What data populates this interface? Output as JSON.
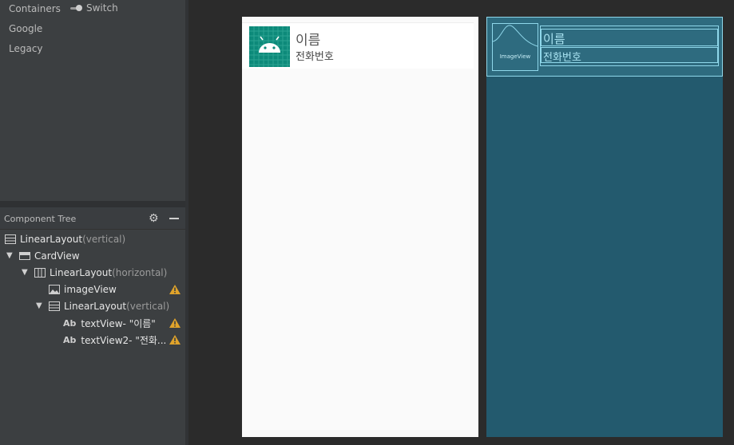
{
  "palette": {
    "categories": [
      "Containers",
      "Google",
      "Legacy"
    ],
    "switch_label": "Switch"
  },
  "component_tree": {
    "title": "Component Tree",
    "nodes": [
      {
        "name": "LinearLayout",
        "detail": "(vertical)"
      },
      {
        "name": "CardView",
        "detail": ""
      },
      {
        "name": "LinearLayout",
        "detail": "(horizontal)"
      },
      {
        "name": "imageView",
        "detail": ""
      },
      {
        "name": "LinearLayout",
        "detail": "(vertical)"
      },
      {
        "name": "textView- \"이름\"",
        "detail": ""
      },
      {
        "name": "textView2- \"전화...",
        "detail": ""
      }
    ],
    "text_icon": "Ab"
  },
  "design": {
    "name": "이름",
    "phone": "전화번호"
  },
  "blueprint": {
    "image_label": "ImageView",
    "name": "이름",
    "phone": "전화번호"
  },
  "colors": {
    "warning": "#e0a32a",
    "blueprint_bg": "#235a6e",
    "blueprint_line": "#8fd7ea",
    "android_icon_bg": "#0d8a7a"
  },
  "icons": [
    "switch-icon",
    "gear-icon",
    "minus-icon",
    "vertical-layout-icon",
    "cardview-icon",
    "horizontal-layout-icon",
    "image-icon",
    "warning-icon",
    "android-icon"
  ]
}
